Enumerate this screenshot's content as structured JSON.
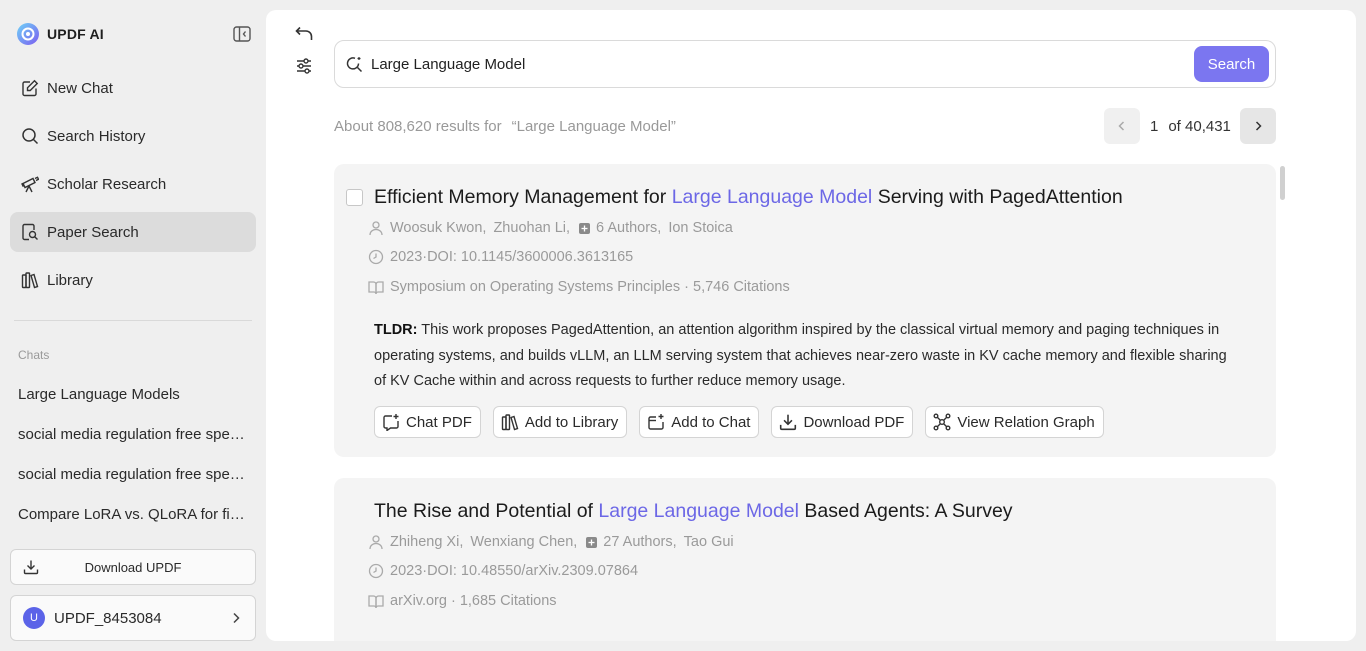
{
  "brand": {
    "name": "UPDF AI"
  },
  "nav": [
    {
      "label": "New Chat",
      "icon": "edit-icon"
    },
    {
      "label": "Search History",
      "icon": "search-icon"
    },
    {
      "label": "Scholar Research",
      "icon": "telescope-icon"
    },
    {
      "label": "Paper Search",
      "icon": "document-search-icon",
      "active": true
    },
    {
      "label": "Library",
      "icon": "books-icon"
    }
  ],
  "chats": {
    "label": "Chats",
    "items": [
      "Large Language Models",
      "social media regulation free speech",
      "social media regulation free speech",
      "Compare LoRA vs. QLoRA for fine-tuning"
    ]
  },
  "sidebar_footer": {
    "download_label": "Download UPDF",
    "user_initial": "U",
    "user_name": "UPDF_8453084"
  },
  "search": {
    "query": "Large Language Model",
    "button_label": "Search"
  },
  "results": {
    "summary": "About 808,620 results for",
    "query_quoted": "“Large Language Model”",
    "current_page": "1",
    "total_pages": "of 40,431"
  },
  "papers": [
    {
      "title_before": "Efficient Memory Management for ",
      "title_highlight": "Large Language Model",
      "title_after": " Serving with PagedAttention",
      "author_1": "Woosuk Kwon,",
      "author_2": "Zhuohan Li,",
      "more_authors": "6 Authors,",
      "author_last": "Ion Stoica",
      "year_doi": "2023·DOI: 10.1145/3600006.3613165",
      "venue": "Symposium on Operating Systems Principles · 5,746 Citations",
      "tldr_label": "TLDR:",
      "tldr_text": " This work proposes PagedAttention, an attention algorithm inspired by the classical virtual memory and paging techniques in operating systems, and builds vLLM, an LLM serving system that achieves near-zero waste in KV cache memory and flexible sharing of KV Cache within and across requests to further reduce memory usage."
    },
    {
      "title_before": "The Rise and Potential of ",
      "title_highlight": "Large Language Model",
      "title_after": " Based Agents: A Survey",
      "author_1": "Zhiheng Xi,",
      "author_2": "Wenxiang Chen,",
      "more_authors": "27 Authors,",
      "author_last": "Tao Gui",
      "year_doi": "2023·DOI: 10.48550/arXiv.2309.07864",
      "venue": "arXiv.org · 1,685 Citations"
    }
  ],
  "actions": [
    "Chat PDF",
    "Add to Library",
    "Add to Chat",
    "Download PDF",
    "View Relation Graph"
  ],
  "colors": {
    "accent": "#7b76f0",
    "highlight": "#6c67e6",
    "avatar": "#5b63e8"
  }
}
